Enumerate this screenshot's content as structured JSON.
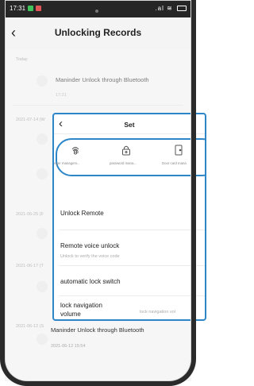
{
  "status": {
    "time": "17:31",
    "right": ".al ≋"
  },
  "header": {
    "title": "Unlocking Records"
  },
  "list": {
    "sections": [
      {
        "date": "Today"
      },
      {
        "date": "2021-07-14 (W"
      },
      {
        "date": "2021-06-25 (F"
      },
      {
        "date": "2021-06-17 (T"
      },
      {
        "date": "2021-06-12 (S"
      }
    ],
    "top_record": {
      "text": "Maninder Unlock through Bluetooth",
      "time": "17:21"
    },
    "bottom_record": {
      "text": "Maninder Unlock through Bluetooth",
      "time": "2021-06-12 15:54"
    }
  },
  "panel": {
    "title": "Set",
    "icons": [
      {
        "name": "fingerprint-icon",
        "label": "finger managem..."
      },
      {
        "name": "lock-icon",
        "label": "password mana..."
      },
      {
        "name": "door-card-icon",
        "label": "Door card mana"
      }
    ],
    "items": [
      {
        "label": "Unlock Remote"
      },
      {
        "label": "Remote voice unlock",
        "sub": "Unlock to verify the voice code"
      },
      {
        "label": "automatic lock switch"
      },
      {
        "label": "lock navigation\nvolume",
        "value": "lock navigation vol"
      }
    ]
  },
  "colors": {
    "accent": "#2d86c7",
    "status_green": "#3fc35a",
    "status_red": "#e05555"
  }
}
